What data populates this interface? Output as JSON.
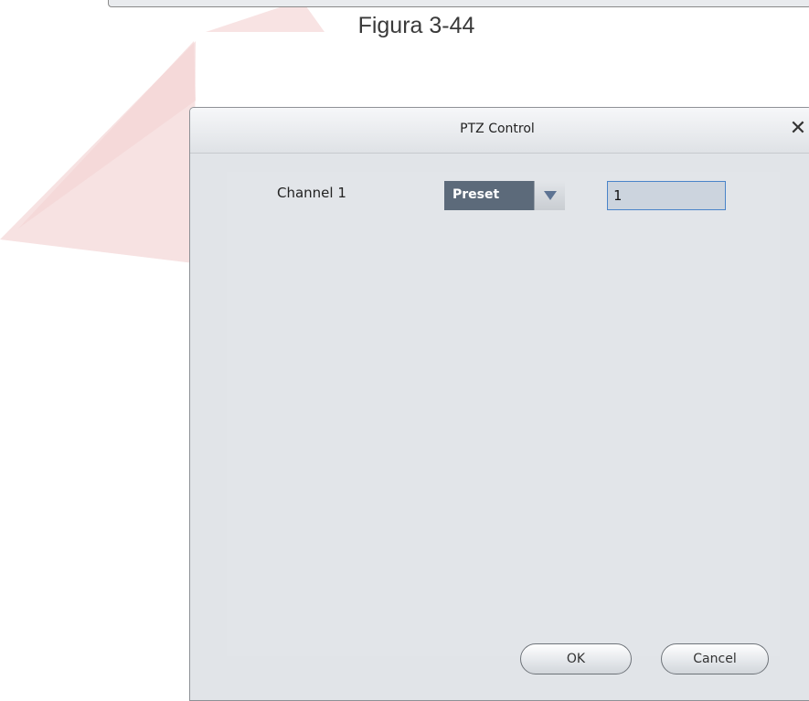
{
  "figure": {
    "caption": "Figura 3-44"
  },
  "dialog": {
    "title": "PTZ Control",
    "close_symbol": "✕",
    "channel_label": "Channel 1",
    "mode_select": {
      "selected": "Preset"
    },
    "preset_input": {
      "value": "1"
    },
    "buttons": {
      "ok": "OK",
      "cancel": "Cancel"
    }
  },
  "colors": {
    "select_bg": "#5c6a7a",
    "input_border": "#4a84c9",
    "dialog_bg": "#e1e4e8",
    "watermark": "#f3d6d6"
  },
  "icons": {
    "close": "close-icon",
    "dropdown": "chevron-down-icon"
  }
}
